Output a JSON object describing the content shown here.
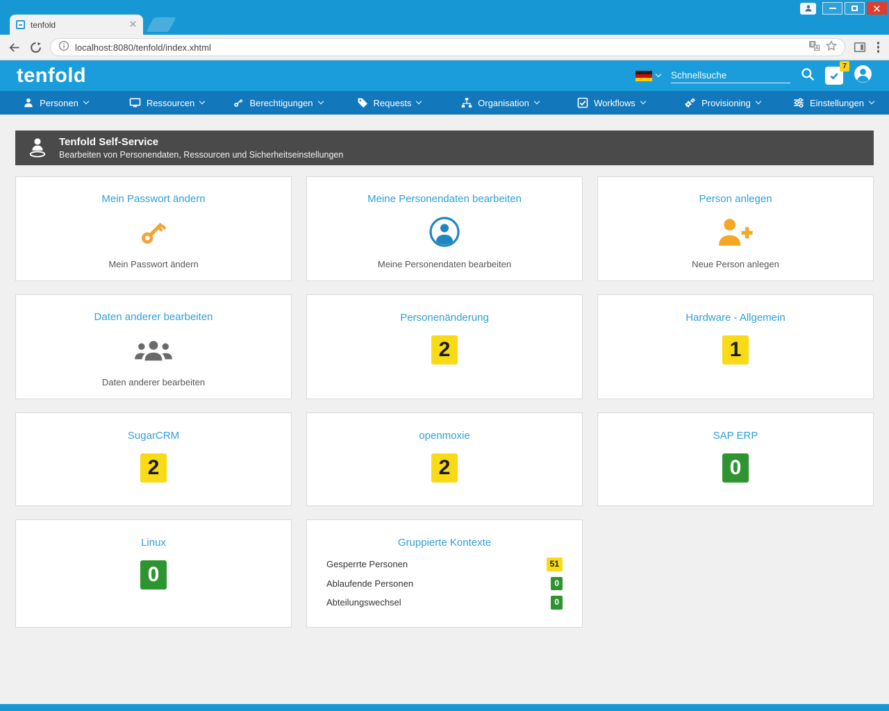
{
  "colors": {
    "frame_blue": "#1798d4",
    "header_blue": "#1a9dda",
    "nav_blue": "#1377bb",
    "page_header_gray": "#4a4a4a",
    "card_title_blue": "#2f9fd8",
    "badge_yellow": "#f8da16",
    "badge_green": "#2e9430",
    "icon_orange": "#f2a33a",
    "icon_blue": "#1d87c2",
    "icon_gray": "#6a6a6a"
  },
  "browser": {
    "tab_title": "tenfold",
    "url": "localhost:8080/tenfold/index.xhtml"
  },
  "app_header": {
    "logo": "tenfold",
    "search_placeholder": "Schnellsuche",
    "tasks_badge": "7"
  },
  "nav": {
    "items": [
      {
        "label": "Personen",
        "icon": "person-icon"
      },
      {
        "label": "Ressourcen",
        "icon": "monitor-icon"
      },
      {
        "label": "Berechtigungen",
        "icon": "key-icon"
      },
      {
        "label": "Requests",
        "icon": "tag-icon"
      },
      {
        "label": "Organisation",
        "icon": "org-chart-icon"
      },
      {
        "label": "Workflows",
        "icon": "checkbox-icon"
      },
      {
        "label": "Provisioning",
        "icon": "gears-icon"
      },
      {
        "label": "Einstellungen",
        "icon": "sliders-icon"
      }
    ]
  },
  "page_header": {
    "title": "Tenfold Self-Service",
    "subtitle": "Bearbeiten von Personendaten, Ressourcen und Sicherheitseinstellungen"
  },
  "cards": {
    "passwort": {
      "title": "Mein Passwort ändern",
      "caption": "Mein Passwort ändern",
      "icon": "key-icon"
    },
    "personendaten": {
      "title": "Meine Personendaten bearbeiten",
      "caption": "Meine Personendaten bearbeiten",
      "icon": "person-circle-icon"
    },
    "person_anlegen": {
      "title": "Person anlegen",
      "caption": "Neue Person anlegen",
      "icon": "person-plus-icon"
    },
    "daten_anderer": {
      "title": "Daten anderer bearbeiten",
      "caption": "Daten anderer bearbeiten",
      "icon": "people-group-icon"
    },
    "personenaenderung": {
      "title": "Personenänderung",
      "count": "2",
      "badge": "yellow"
    },
    "hardware": {
      "title": "Hardware - Allgemein",
      "count": "1",
      "badge": "yellow"
    },
    "sugarcrm": {
      "title": "SugarCRM",
      "count": "2",
      "badge": "yellow"
    },
    "openmoxie": {
      "title": "openmoxie",
      "count": "2",
      "badge": "yellow"
    },
    "sap_erp": {
      "title": "SAP ERP",
      "count": "0",
      "badge": "green"
    },
    "linux": {
      "title": "Linux",
      "count": "0",
      "badge": "green"
    },
    "gruppierte_kontexte": {
      "title": "Gruppierte Kontexte",
      "items": [
        {
          "label": "Gesperrte Personen",
          "count": "51",
          "badge": "yellow"
        },
        {
          "label": "Ablaufende Personen",
          "count": "0",
          "badge": "green"
        },
        {
          "label": "Abteilungswechsel",
          "count": "0",
          "badge": "green"
        }
      ]
    }
  }
}
